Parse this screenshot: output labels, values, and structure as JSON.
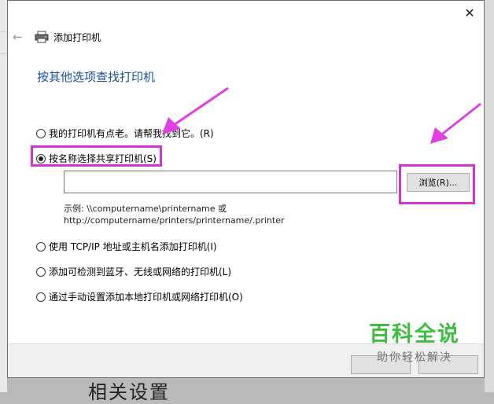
{
  "window": {
    "title": "添加打印机",
    "close_glyph": "✕",
    "back_glyph": "←"
  },
  "heading": "按其他选项查找打印机",
  "options": [
    {
      "label": "我的打印机有点老。请帮我找到它。(R)",
      "checked": false
    },
    {
      "label": "按名称选择共享打印机(S)",
      "checked": true
    },
    {
      "label": "使用 TCP/IP 地址或主机名添加打印机(I)",
      "checked": false
    },
    {
      "label": "添加可检测到蓝牙、无线或网络的打印机(L)",
      "checked": false
    },
    {
      "label": "通过手动设置添加本地打印机或网络打印机(O)",
      "checked": false
    }
  ],
  "shared_printer": {
    "input_value": "",
    "browse_label": "浏览(R)...",
    "example_line1": "示例: \\\\computername\\printername 或",
    "example_line2": "http://computername/printers/printername/.printer"
  },
  "background": {
    "bottom_text": "相关设置"
  },
  "watermark": {
    "main": "百科全说",
    "sub": "助你轻松解决"
  },
  "colors": {
    "heading": "#1a4fa0",
    "highlight": "#d433d4",
    "watermark_green": "#3fbf3f"
  }
}
